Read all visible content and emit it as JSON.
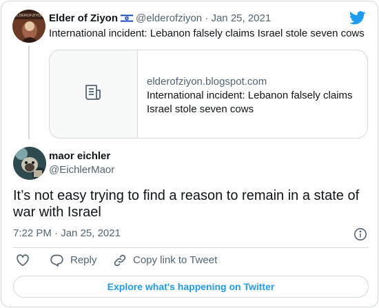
{
  "parent_tweet": {
    "author_name": "Elder of Ziyon",
    "handle": "@elderofziyon",
    "separator": "·",
    "date": "Jan 25, 2021",
    "text": "International incident: Lebanon falsely claims Israel stole seven cows",
    "avatar_text": "ELDEROFZIYON",
    "link_card": {
      "domain": "elderofziyon.blogspot.com",
      "title": "International incident: Lebanon falsely claims Israel stole seven cows",
      "icon": "document-icon"
    }
  },
  "tweet": {
    "author_name": "maor eichler",
    "handle": "@EichlerMaor",
    "text": "It’s not easy trying to find a reason to remain in a state of war with Israel",
    "time": "7:22 PM · Jan 25, 2021"
  },
  "actions": {
    "like_icon": "heart-icon",
    "reply_label": "Reply",
    "copy_label": "Copy link to Tweet"
  },
  "explore_label": "Explore what's happening on Twitter",
  "colors": {
    "accent": "#1d9bf0",
    "secondary_text": "#536471",
    "border": "#cfd9de"
  }
}
